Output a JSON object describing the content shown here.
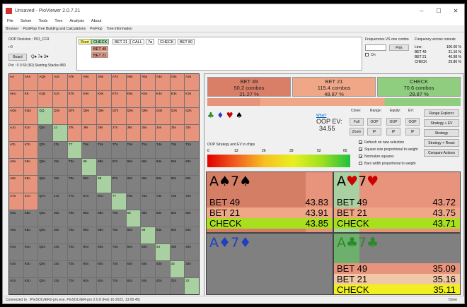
{
  "window": {
    "title": "Unsaved - PioViewer 2.0.7.21"
  },
  "menu": [
    "File",
    "Solver",
    "Tools",
    "Tree",
    "Analysis",
    "About"
  ],
  "tabs": [
    "Browser",
    "PostFlop Tree Building and Calculations",
    "PreFlop",
    "Tree information"
  ],
  "left_panel": {
    "decision": "OOP Decision : PIO_CFR",
    "sub": "r:0",
    "board_button": "Board",
    "board_cards": "Q♠ 7♠ 3♥",
    "pot": "Pot : 0 0 60 (60) Starting Stacks:480"
  },
  "tree_nodes": [
    "Root",
    "CHECK",
    "BET 21",
    "CALL",
    "7♠",
    "CHECK",
    "BET 80"
  ],
  "tree_sub": [
    "BET 49",
    "BET 21"
  ],
  "freq_panel": {
    "label_combo": "Frequencies VS one combo",
    "pick": "Pick",
    "on": "On",
    "label_runouts": "Frequency across runouts",
    "rows": [
      [
        "Line:",
        "100.00 %"
      ],
      [
        "BET 49",
        "21.16 %"
      ],
      [
        "BET 21",
        "40.98 %"
      ],
      [
        "CHECK",
        "29.86 %"
      ]
    ]
  },
  "actions": [
    {
      "name": "BET 49",
      "combos": "50.2 combos",
      "pct": "21.27 %",
      "color": "#e8937b"
    },
    {
      "name": "BET 21",
      "combos": "115.4 combos",
      "pct": "48.87 %",
      "color": "#f0a787"
    },
    {
      "name": "CHECK",
      "combos": "70.6 combos",
      "pct": "29.87 %",
      "color": "#8fce7f"
    }
  ],
  "controls": {
    "suits": [
      "♣",
      "♦",
      "♥",
      "♠"
    ],
    "what": "What?",
    "oop_ev_label": "OOP EV:",
    "oop_ev": "34.55",
    "clone": "Clone:",
    "range": "Range:",
    "equity": "Equity:",
    "ev": "EV:",
    "btn_full": "Full",
    "btn_zoom": "Zoom",
    "btn_oop": "OOP",
    "btn_ip": "IP",
    "range_explorer": "Range Explorer",
    "strategy_ev": "Strategy + EV",
    "strategy": "Strategy",
    "strategy_react": "Strategy + React",
    "compare": "Compare Actions",
    "checks": [
      "Refresh on new selection",
      "Square size proportional to weight",
      "Normalize squares",
      "Bars width proportional to weight"
    ],
    "scale_label": "OOP Strategy and EV in chips",
    "scale_ticks": [
      "0",
      "13",
      "26",
      "39",
      "52",
      "65"
    ]
  },
  "cards": [
    {
      "hand_rank1": "A",
      "suit1": "♠",
      "rank2": "7",
      "suit2": "♠",
      "color": "#111",
      "rows": [
        [
          "BET 49",
          "43.83"
        ],
        [
          "BET 21",
          "43.91"
        ],
        [
          "CHECK",
          "43.85"
        ]
      ]
    },
    {
      "hand_rank1": "A",
      "suit1": "♥",
      "rank2": "7",
      "suit2": "♥",
      "color": "#c00",
      "rows": [
        [
          "BET 49",
          "43.72"
        ],
        [
          "BET 21",
          "43.75"
        ],
        [
          "CHECK",
          "43.71"
        ]
      ]
    },
    {
      "hand_rank1": "A",
      "suit1": "♦",
      "rank2": "7",
      "suit2": "♦",
      "color": "#2040c0",
      "rows": []
    },
    {
      "hand_rank1": "A",
      "suit1": "♣",
      "rank2": "7",
      "suit2": "♣",
      "color": "#2a8a2a",
      "rows": [
        [
          "BET 49",
          "35.09"
        ],
        [
          "BET 21",
          "35.16"
        ],
        [
          "CHECK",
          "35.11"
        ]
      ]
    }
  ],
  "grid_labels": [
    "AA",
    "AKs",
    "AQs",
    "AJs",
    "ATs",
    "A9s",
    "A8s",
    "A7s",
    "A6s",
    "A5s",
    "A4s",
    "A3s",
    "A2s",
    "AKo",
    "KK",
    "KQs",
    "KJs",
    "KTs",
    "K9s",
    "K8s",
    "K7s",
    "K6s",
    "K5s",
    "K4s",
    "K3s",
    "K2s",
    "AQo",
    "KQo",
    "QQ",
    "QJs",
    "QTs",
    "Q9s",
    "Q8s",
    "Q7s",
    "Q6s",
    "Q5s",
    "Q4s",
    "Q3s",
    "Q2s",
    "AJo",
    "KJo",
    "QJo",
    "JJ",
    "JTs",
    "J9s",
    "J8s",
    "J7s",
    "J6s",
    "J5s",
    "J4s",
    "J3s",
    "J2s",
    "ATo",
    "KTo",
    "QTo",
    "JTo",
    "TT",
    "T9s",
    "T8s",
    "T7s",
    "T6s",
    "T5s",
    "T4s",
    "T3s",
    "T2s",
    "A9o",
    "K9o",
    "Q9o",
    "J9o",
    "T9o",
    "99",
    "98s",
    "97s",
    "96s",
    "95s",
    "94s",
    "93s",
    "92s",
    "A8o",
    "K8o",
    "Q8o",
    "J8o",
    "T8o",
    "98o",
    "88",
    "87s",
    "86s",
    "85s",
    "84s",
    "83s",
    "82s",
    "A7o",
    "K7o",
    "Q7o",
    "J7o",
    "T7o",
    "97o",
    "87o",
    "77",
    "76s",
    "75s",
    "74s",
    "73s",
    "72s",
    "A6o",
    "K6o",
    "Q6o",
    "J6o",
    "T6o",
    "96o",
    "86o",
    "76o",
    "66",
    "65s",
    "64s",
    "63s",
    "62s",
    "A5o",
    "K5o",
    "Q5o",
    "J5o",
    "T5o",
    "95o",
    "85o",
    "75o",
    "65o",
    "55",
    "54s",
    "53s",
    "52s",
    "A4o",
    "K4o",
    "Q4o",
    "J4o",
    "T4o",
    "94o",
    "84o",
    "74o",
    "64o",
    "54o",
    "44",
    "43s",
    "42s",
    "A3o",
    "K3o",
    "Q3o",
    "J3o",
    "T3o",
    "93o",
    "83o",
    "73o",
    "63o",
    "53o",
    "43o",
    "33",
    "32s",
    "A2o",
    "K2o",
    "Q2o",
    "J2o",
    "T2o",
    "92o",
    "82o",
    "72o",
    "62o",
    "52o",
    "42o",
    "32o",
    "22"
  ],
  "status": {
    "left": "Connected to : /PioSOLVER2-pro.exe. PioSOLVER-pro 2.0.8 (Feb 16 2022, 13:05:45)",
    "right": "Done"
  }
}
